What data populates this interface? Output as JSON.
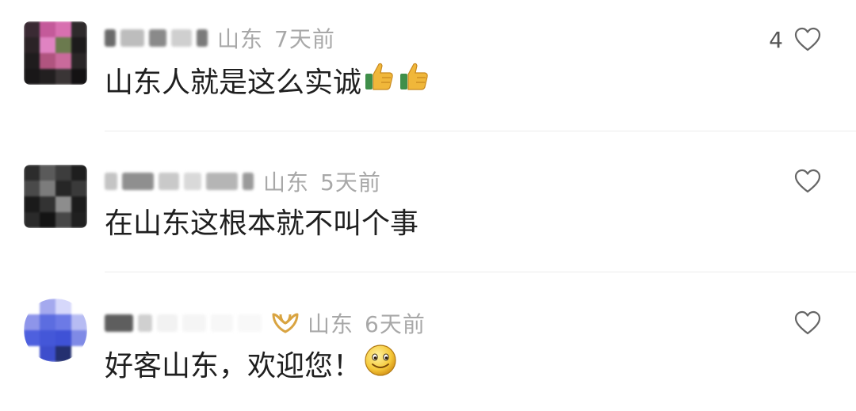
{
  "comments": [
    {
      "location": "山东",
      "time": "7天前",
      "text": "山东人就是这么实诚",
      "emojis": [
        "thumbs-up-icon",
        "thumbs-up-icon"
      ],
      "like_count": "4"
    },
    {
      "location": "山东",
      "time": "5天前",
      "text": "在山东这根本就不叫个事",
      "emojis": [],
      "like_count": ""
    },
    {
      "location": "山东",
      "time": "6天前",
      "text": "好客山东，欢迎您！",
      "emojis": [
        "smiley-face-icon"
      ],
      "like_count": "",
      "badge": "vip-badge-icon"
    }
  ],
  "colors": {
    "meta_gray": "#a8a8a8",
    "text_dark": "#1f1f1f",
    "heart_stroke": "#666666",
    "badge_gold": "#d9a441",
    "divider": "#ececec"
  }
}
